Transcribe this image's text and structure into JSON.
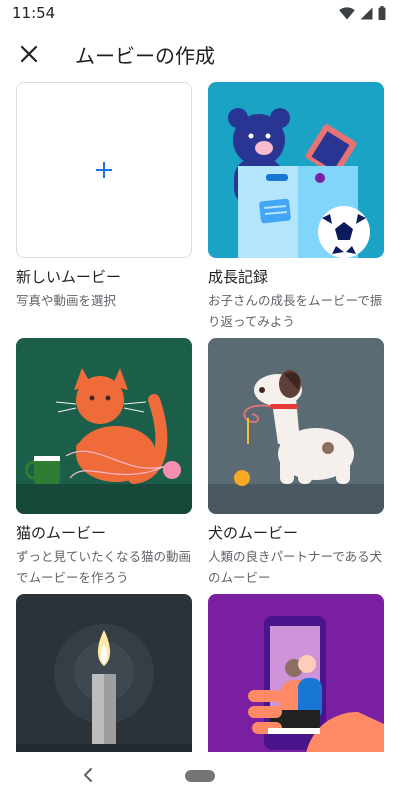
{
  "status_bar": {
    "time": "11:54"
  },
  "app_bar": {
    "title": "ムービーの作成"
  },
  "cards": [
    {
      "title": "新しいムービー",
      "desc": "写真や動画を選択"
    },
    {
      "title": "成長記録",
      "desc": "お子さんの成長をムービーで振り返ってみよう"
    },
    {
      "title": "猫のムービー",
      "desc": "ずっと見ていたくなる猫の動画でムービーを作ろう"
    },
    {
      "title": "犬のムービー",
      "desc": "人類の良きパートナーである犬のムービー"
    }
  ],
  "colors": {
    "accent": "#1a73e8",
    "growth_bg": "#1ba3c6",
    "cat_bg": "#1b5e4a",
    "dog_bg": "#5b6b74",
    "candle_bg": "#2b3338",
    "selfie_bg": "#7b1fa2"
  }
}
